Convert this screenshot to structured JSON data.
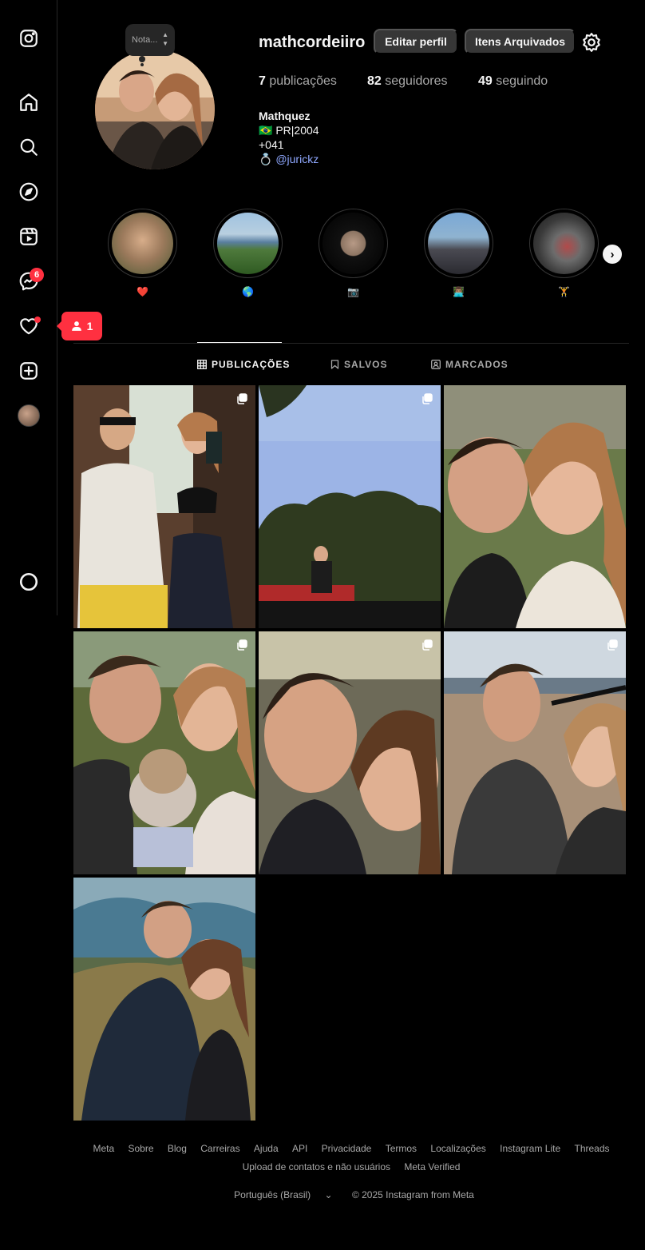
{
  "sidebar": {
    "icons": [
      "instagram-logo-icon",
      "home-icon",
      "search-icon",
      "explore-icon",
      "reels-icon",
      "messenger-icon",
      "heart-icon",
      "create-icon",
      "profile-avatar",
      "threads-icon"
    ],
    "messages_badge": "6",
    "notification_popup_count": "1"
  },
  "profile": {
    "note_placeholder": "Nota...",
    "username": "mathcordeiiro",
    "edit_button": "Editar perfil",
    "archive_button": "Itens Arquivados",
    "stats": {
      "posts_count": "7",
      "posts_label": "publicações",
      "followers_count": "82",
      "followers_label": "seguidores",
      "following_count": "49",
      "following_label": "seguindo"
    },
    "bio": {
      "name": "Mathquez",
      "line1": "🇧🇷 PR|2004",
      "line2": "+041",
      "line3_prefix": "💍",
      "line3_link": "@jurickz"
    }
  },
  "highlights": [
    {
      "label": "❤️"
    },
    {
      "label": "🌎"
    },
    {
      "label": "📷"
    },
    {
      "label": "👨🏽‍💻"
    },
    {
      "label": "🏋️"
    }
  ],
  "tabs": {
    "posts": "PUBLICAÇÕES",
    "saved": "SALVOS",
    "tagged": "MARCADOS"
  },
  "footer": {
    "links_row1": [
      "Meta",
      "Sobre",
      "Blog",
      "Carreiras",
      "Ajuda",
      "API",
      "Privacidade",
      "Termos",
      "Localizações",
      "Instagram Lite",
      "Threads"
    ],
    "links_row2": [
      "Upload de contatos e não usuários",
      "Meta Verified"
    ],
    "language": "Português (Brasil)",
    "copyright": "© 2025 Instagram from Meta"
  }
}
